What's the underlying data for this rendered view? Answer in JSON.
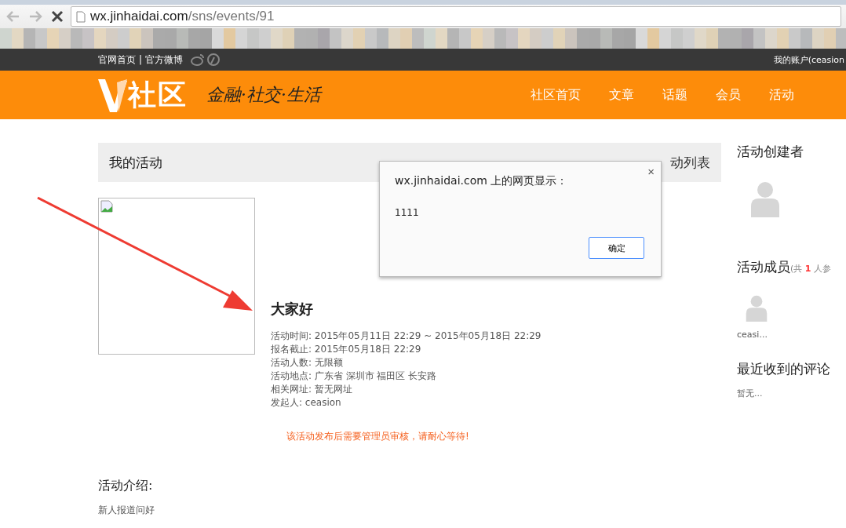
{
  "browser": {
    "host": "wx.jinhaidai.com",
    "path": "/sns/events/91"
  },
  "topbar": {
    "links": [
      "官网首页",
      "官方微博"
    ],
    "separator": "|",
    "account": "我的账户(ceasion"
  },
  "header": {
    "logo_text": "社区",
    "slogan": "金融·社交·生活",
    "nav": [
      "社区首页",
      "文章",
      "话题",
      "会员",
      "活动"
    ]
  },
  "main": {
    "title": "我的活动",
    "back_link": "动列表",
    "event": {
      "name": "大家好",
      "details": [
        "活动时间: 2015年05月11日 22:29 ~ 2015年05月18日 22:29",
        "报名截止: 2015年05月18日 22:29",
        "活动人数: 无限额",
        "活动地点: 广东省 深圳市 福田区 长安路",
        "相关网址: 暂无网址",
        "发起人: ceasion"
      ],
      "notice": "该活动发布后需要管理员审核，请耐心等待!"
    },
    "intro": {
      "heading": "活动介绍:",
      "text": "新人报道问好"
    }
  },
  "sidebar": {
    "creator_heading": "活动创建者",
    "members_heading": "活动成员",
    "members_prefix": "(共",
    "members_count": "1",
    "members_suffix": "人参",
    "members": [
      {
        "name": "ceasi..."
      }
    ],
    "comments_heading": "最近收到的评论",
    "comments_empty": "暂无..."
  },
  "dialog": {
    "title": "wx.jinhaidai.com 上的网页显示：",
    "message": "1111",
    "ok": "确定",
    "close": "×"
  }
}
